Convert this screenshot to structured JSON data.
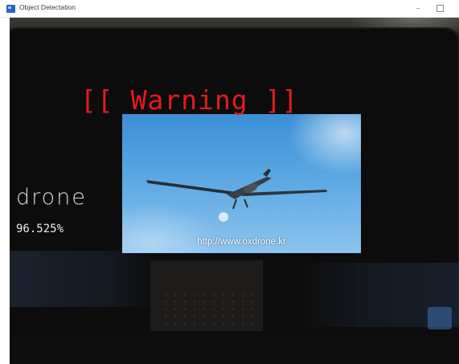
{
  "window": {
    "title": "Object Detectation",
    "app_icon": "window-app-icon",
    "controls": {
      "minimize": "–"
    }
  },
  "overlay": {
    "warning": "[[ Warning ]]",
    "warning_color": "#e51b1b",
    "detection": {
      "label": "drone",
      "confidence": "96.525%"
    }
  },
  "photo": {
    "url": "http://www.oxdrone.kr"
  }
}
